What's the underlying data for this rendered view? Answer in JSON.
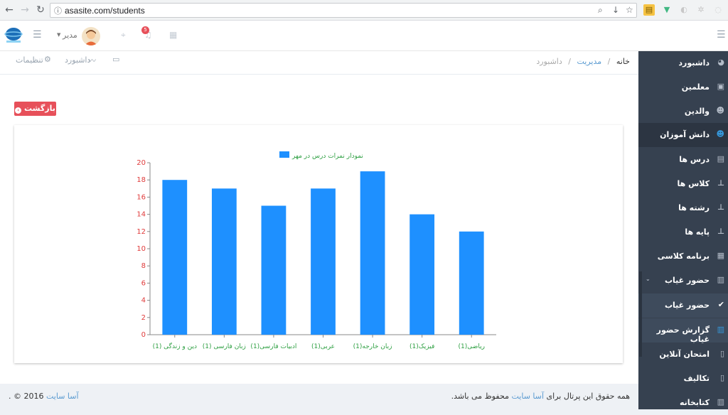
{
  "browser": {
    "url": "asasite.com/students",
    "info_icon": "info-icon"
  },
  "topbar": {
    "user_name": "مدیر",
    "notification_count": "5"
  },
  "breadcrumb": {
    "home": "خانه",
    "admin": "مدیریت",
    "dashboard": "داشبورد"
  },
  "page_toolbar": {
    "dashboard": "داشبورد",
    "settings": "تنظیمات"
  },
  "back_button": "بازگشت",
  "sidebar": {
    "items": [
      {
        "label": "داشبورد",
        "icon": "dashboard-icon"
      },
      {
        "label": "معلمین",
        "icon": "briefcase-icon"
      },
      {
        "label": "والدین",
        "icon": "users-icon"
      },
      {
        "label": "دانش آموزان",
        "icon": "users-icon"
      },
      {
        "label": "درس ها",
        "icon": "book-icon"
      },
      {
        "label": "کلاس ها",
        "icon": "sitemap-icon"
      },
      {
        "label": "رشته ها",
        "icon": "sitemap-icon"
      },
      {
        "label": "پایه ها",
        "icon": "sitemap-icon"
      },
      {
        "label": "برنامه کلاسی",
        "icon": "grid-icon"
      },
      {
        "label": "حضور غیاب",
        "icon": "bar-chart-icon"
      },
      {
        "label": "حضور غیاب",
        "icon": "check-icon"
      },
      {
        "label": "گزارش حضور غیاب",
        "icon": "bar-chart-icon"
      },
      {
        "label": "امتحان آنلاین",
        "icon": "file-icon"
      },
      {
        "label": "تکالیف",
        "icon": "file-pdf-icon"
      },
      {
        "label": "کتابخانه",
        "icon": "library-icon"
      }
    ],
    "active_color": "#3598dc"
  },
  "chart_data": {
    "type": "bar",
    "categories": [
      "دین و زندگی (1)",
      "زبان فارسی (1)",
      "ادبیات فارسی(1)",
      "عربی(1)",
      "زبان خارجه(1)",
      "فیزیک(1)",
      "ریاضی(1)"
    ],
    "series": [
      {
        "name": "نمودار نمرات درس در مهر",
        "values": [
          18,
          17,
          15,
          17,
          19,
          14,
          12
        ],
        "color": "#1e90ff"
      }
    ],
    "ylim": [
      0,
      20
    ],
    "yticks": [
      "0",
      "2",
      "4",
      "6",
      "8",
      "10",
      "12",
      "14",
      "16",
      "18",
      "20"
    ],
    "legend_position": "top-center",
    "grid": false
  },
  "footer": {
    "rights_prefix": "همه حقوق این پرتال برای",
    "site_link": "آسا سایت",
    "rights_suffix": "محفوظ می باشد.",
    "copyright_prefix": "2016 ©",
    "copyright_link": "آسا سایت",
    "copyright_suffix": "."
  }
}
